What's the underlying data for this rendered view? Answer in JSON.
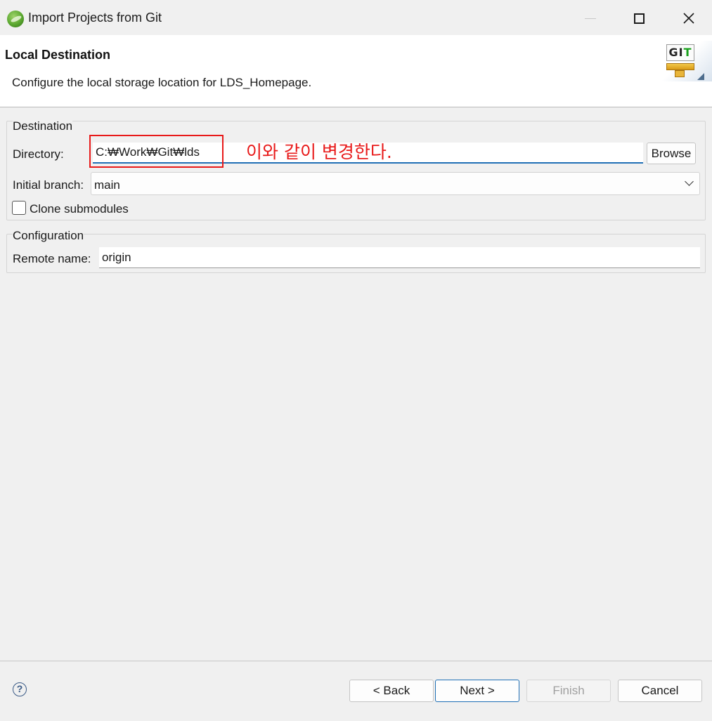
{
  "window": {
    "title": "Import Projects from Git",
    "controls": {
      "minimize": "minimize",
      "maximize": "maximize",
      "close": "✕"
    }
  },
  "header": {
    "title": "Local Destination",
    "description": "Configure the local storage location for LDS_Homepage.",
    "icon": "git-icon",
    "icon_text_gi": "GI",
    "icon_text_t": "T"
  },
  "destination": {
    "group_label": "Destination",
    "directory_label": "Directory:",
    "directory_value": "C:₩Work₩Git₩lds",
    "browse_label": "Browse",
    "initial_branch_label": "Initial branch:",
    "initial_branch_value": "main",
    "clone_submodules_label": "Clone submodules",
    "clone_submodules_checked": false
  },
  "configuration": {
    "group_label": "Configuration",
    "remote_name_label": "Remote name:",
    "remote_name_value": "origin"
  },
  "annotation": {
    "text": "이와 같이 변경한다.",
    "color": "#e81a1a"
  },
  "footer": {
    "help_label": "?",
    "back_label": "< Back",
    "next_label": "Next >",
    "finish_label": "Finish",
    "finish_enabled": false,
    "cancel_label": "Cancel"
  },
  "colors": {
    "accent": "#1f6fb5",
    "background": "#f0f0f0"
  }
}
